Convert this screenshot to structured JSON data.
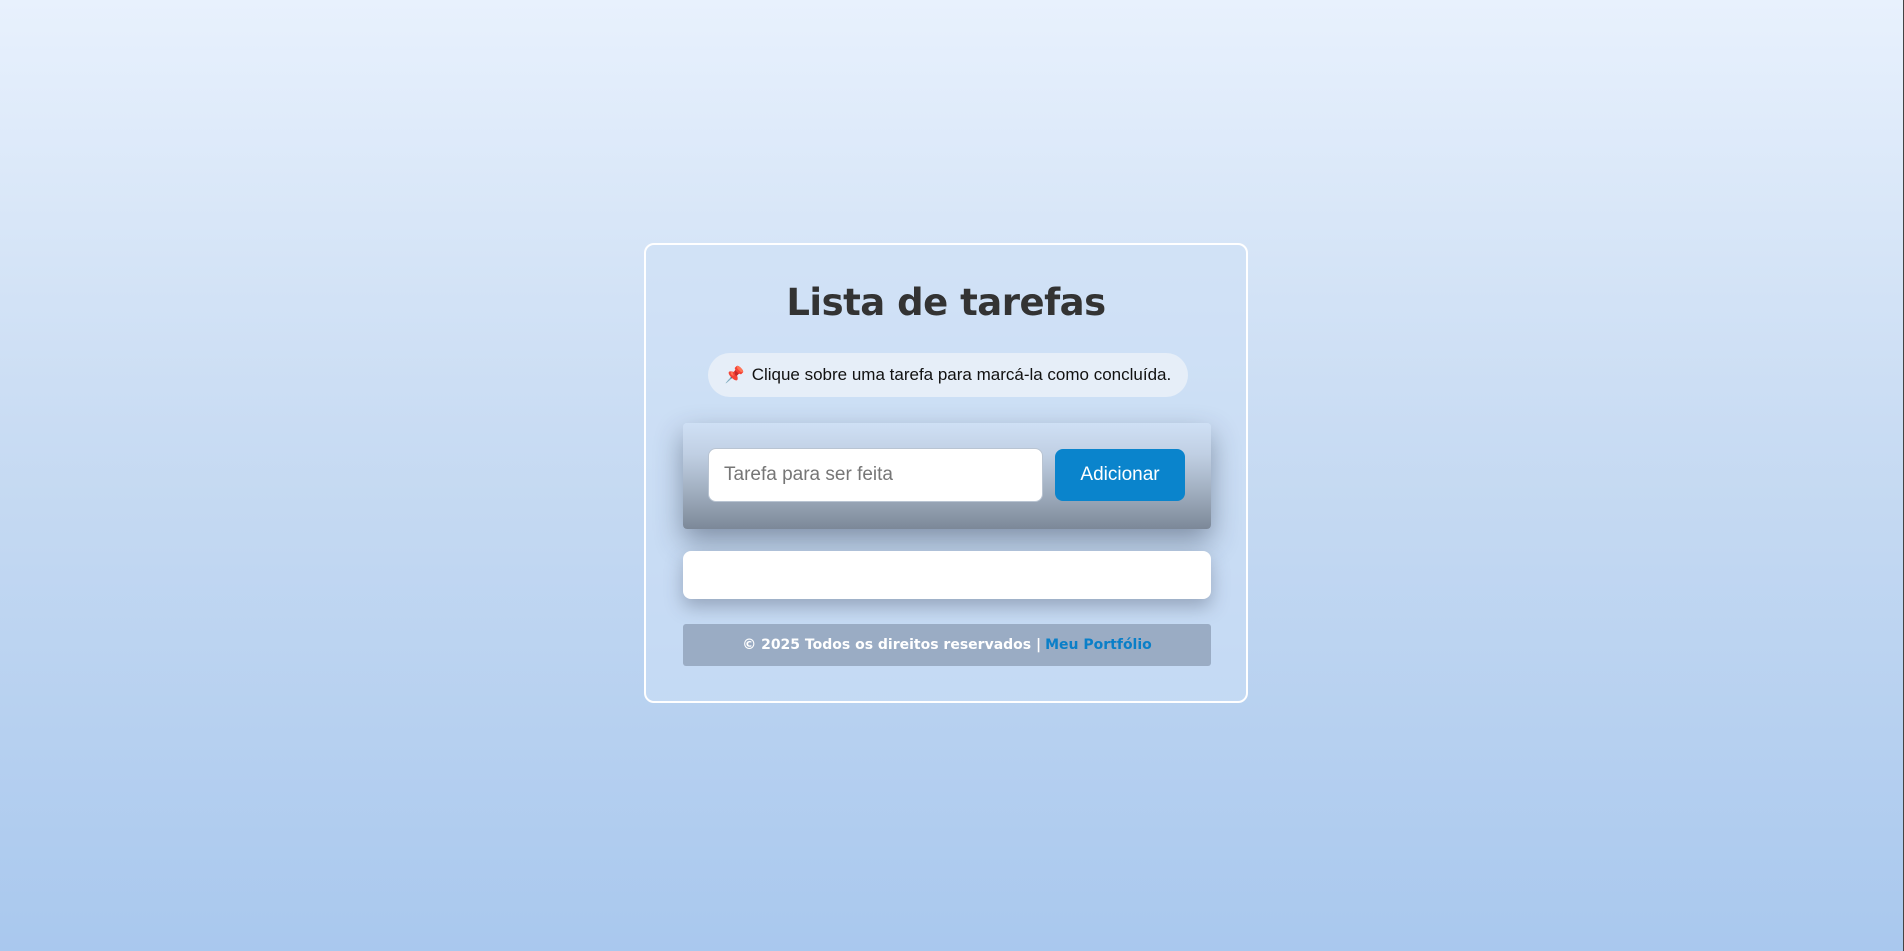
{
  "app": {
    "title": "Lista de tarefas",
    "hint_icon": "pushpin-icon",
    "hint_text": "Clique sobre uma tarefa para marcá-la como concluída."
  },
  "form": {
    "input_value": "",
    "input_placeholder": "Tarefa para ser feita",
    "add_label": "Adicionar"
  },
  "tasks": [],
  "footer": {
    "copyright": "© 2025 Todos os direitos reservados |",
    "link_label": "Meu Portfólio"
  },
  "colors": {
    "accent": "#0a84cc",
    "title": "#333333",
    "footer_bg": "#9aacc4"
  }
}
